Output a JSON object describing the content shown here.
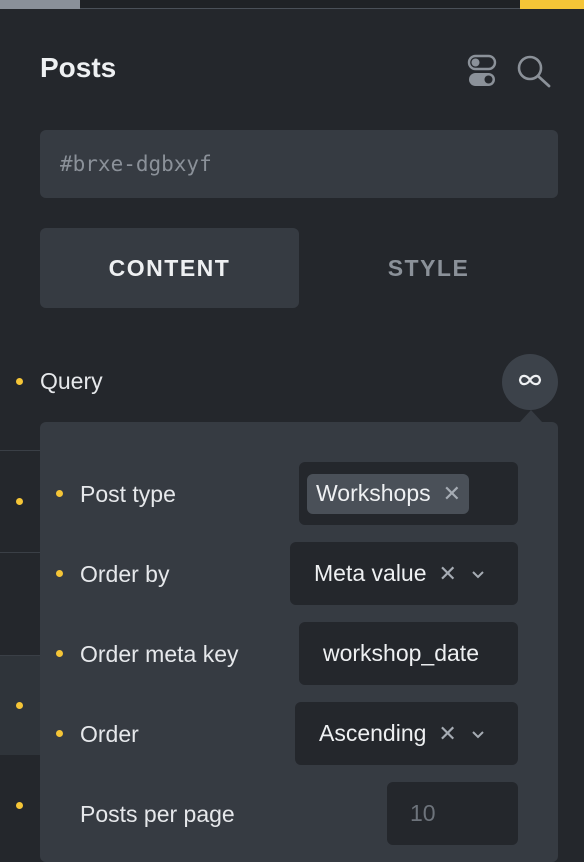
{
  "header": {
    "title": "Posts",
    "element_id_placeholder": "#brxe-dgbxyf"
  },
  "tabs": [
    {
      "label": "CONTENT",
      "active": true
    },
    {
      "label": "STYLE",
      "active": false
    }
  ],
  "query": {
    "label": "Query",
    "icon": "infinity-icon"
  },
  "query_popover": {
    "post_type": {
      "label": "Post type",
      "value": "Workshops"
    },
    "order_by": {
      "label": "Order by",
      "value": "Meta value"
    },
    "order_meta_key": {
      "label": "Order meta key",
      "value": "workshop_date"
    },
    "order": {
      "label": "Order",
      "value": "Ascending"
    },
    "posts_per_page": {
      "label": "Posts per page",
      "placeholder": "10"
    }
  },
  "colors": {
    "accent": "#f5c537",
    "panel_bg": "#24272c",
    "field_bg": "#363b42"
  }
}
